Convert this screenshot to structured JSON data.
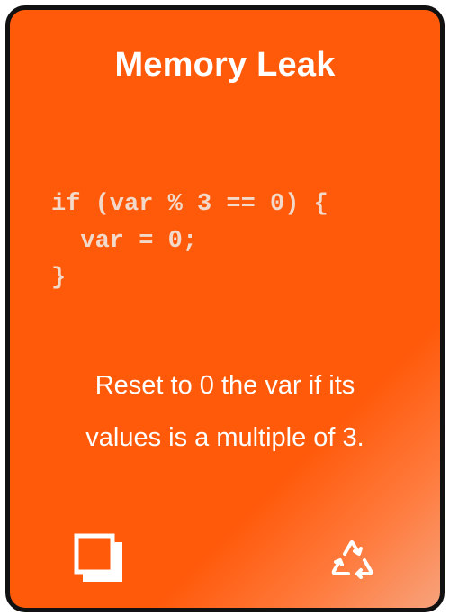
{
  "card": {
    "title": "Memory Leak",
    "code_lines": [
      "if (var % 3 == 0) {",
      "  var = 0;",
      "}"
    ],
    "description_lines": [
      "Reset to 0 the var if its",
      "values is a multiple of 3."
    ],
    "icons": {
      "left": "copy-icon",
      "right": "recycle-icon"
    },
    "colors": {
      "background": "#ff5a0a",
      "border": "#111111",
      "title_text": "#ffffff",
      "code_text": "#f3d9c9"
    }
  }
}
